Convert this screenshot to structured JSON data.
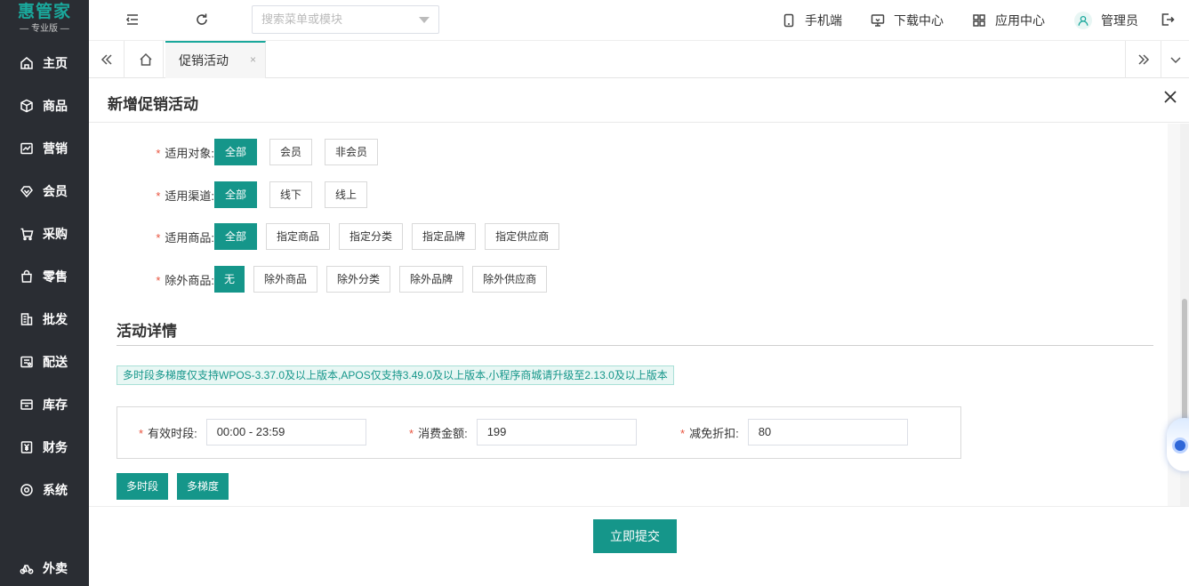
{
  "sidebar": {
    "logo_main": "惠管家",
    "logo_sub": "— 专业版 —",
    "items": [
      {
        "label": "主页",
        "icon": "home-icon"
      },
      {
        "label": "商品",
        "icon": "box-icon"
      },
      {
        "label": "营销",
        "icon": "chart-icon"
      },
      {
        "label": "会员",
        "icon": "diamond-icon"
      },
      {
        "label": "采购",
        "icon": "cart-icon"
      },
      {
        "label": "零售",
        "icon": "bag-icon"
      },
      {
        "label": "批发",
        "icon": "building-icon"
      },
      {
        "label": "配送",
        "icon": "truck-icon"
      },
      {
        "label": "库存",
        "icon": "warehouse-icon"
      },
      {
        "label": "财务",
        "icon": "yen-icon"
      },
      {
        "label": "系统",
        "icon": "settings-icon"
      },
      {
        "label": "外卖",
        "icon": "bike-icon"
      }
    ]
  },
  "header": {
    "search_placeholder": "搜索菜单或模块",
    "mobile": "手机端",
    "download": "下载中心",
    "apps": "应用中心",
    "user": "管理员"
  },
  "tabs": {
    "active": "促销活动",
    "close": "×"
  },
  "page": {
    "title": "新增促销活动"
  },
  "form": {
    "rows": [
      {
        "label": "适用对象:",
        "options": [
          "全部",
          "会员",
          "非会员"
        ],
        "selected": 0
      },
      {
        "label": "适用渠道:",
        "options": [
          "全部",
          "线下",
          "线上"
        ],
        "selected": 0
      },
      {
        "label": "适用商品:",
        "options": [
          "全部",
          "指定商品",
          "指定分类",
          "指定品牌",
          "指定供应商"
        ],
        "selected": 0
      },
      {
        "label": "除外商品:",
        "options": [
          "无",
          "除外商品",
          "除外分类",
          "除外品牌",
          "除外供应商"
        ],
        "selected": 0
      }
    ],
    "required_mark": "*"
  },
  "details": {
    "section_title": "活动详情",
    "notice": "多时段多梯度仅支持WPOS-3.37.0及以上版本,APOS仅支持3.49.0及以上版本,小程序商城请升级至2.13.0及以上版本",
    "time_label": "有效时段:",
    "time_value": "00:00 - 23:59",
    "amount_label": "消费金额:",
    "amount_value": "199",
    "discount_label": "减免折扣:",
    "discount_value": "80",
    "multi_time": "多时段",
    "multi_tier": "多梯度"
  },
  "footer": {
    "submit": "立即提交"
  },
  "colors": {
    "primary": "#15968a",
    "sidebar_bg": "#2a2d33",
    "required": "#e9543f"
  }
}
